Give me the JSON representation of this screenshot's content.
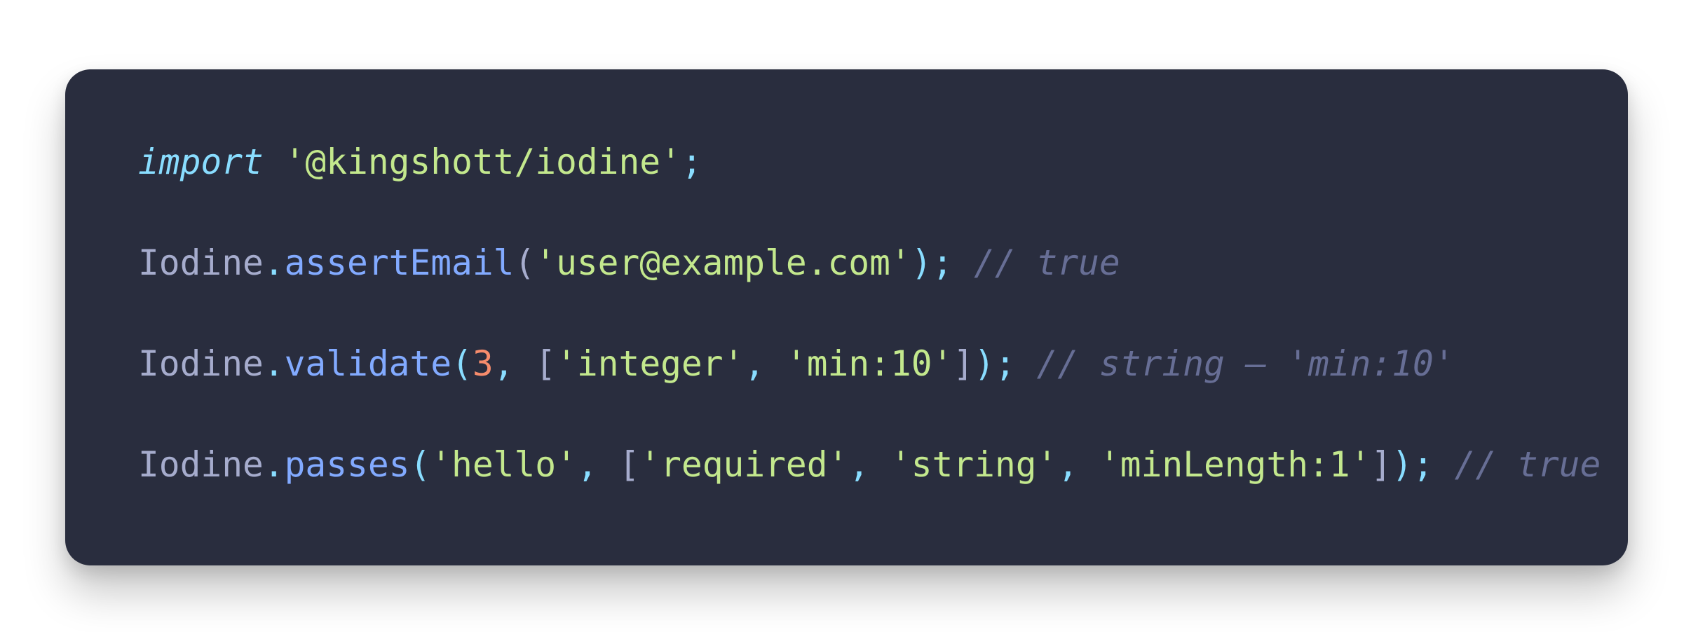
{
  "colors": {
    "background": "#ffffff",
    "card": "#292d3e",
    "keyword": "#89ddff",
    "string": "#c3e88d",
    "function": "#82aaff",
    "number": "#f78c6c",
    "identifier": "#a6accd",
    "comment": "#676e95"
  },
  "code": {
    "line1": {
      "keyword": "import",
      "module": "'@kingshott/iodine'",
      "semicolon": ";"
    },
    "line2": {
      "object": "Iodine",
      "dot": ".",
      "method": "assertEmail",
      "open_paren": "(",
      "arg": "'user@example.com'",
      "close": ");",
      "comment": "// true"
    },
    "line3": {
      "object": "Iodine",
      "dot": ".",
      "method": "validate",
      "open_paren": "(",
      "arg_number": "3",
      "comma1": ",",
      "open_bracket": "[",
      "rule1": "'integer'",
      "comma2": ",",
      "rule2": "'min:10'",
      "close_bracket": "]",
      "close": ");",
      "comment": "// string – 'min:10'"
    },
    "line4": {
      "object": "Iodine",
      "dot": ".",
      "method": "passes",
      "open_paren": "(",
      "arg": "'hello'",
      "comma1": ",",
      "open_bracket": "[",
      "rule1": "'required'",
      "comma2": ",",
      "rule2": "'string'",
      "comma3": ",",
      "rule3": "'minLength:1'",
      "close_bracket": "]",
      "close": ");",
      "comment": "// true"
    }
  }
}
